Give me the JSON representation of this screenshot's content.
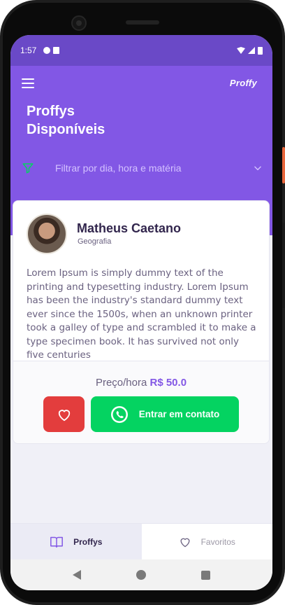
{
  "status_bar": {
    "time": "1:57"
  },
  "header": {
    "brand": "Proffy",
    "title_line1": "Proffys",
    "title_line2": "Disponíveis",
    "filter_label": "Filtrar por dia, hora e matéria"
  },
  "teacher_card": {
    "name": "Matheus Caetano",
    "subject": "Geografia",
    "bio": "Lorem Ipsum is simply dummy text of the printing and typesetting industry. Lorem Ipsum has been the industry's standard dummy text ever since the 1500s, when an unknown printer took a galley of type and scrambled it to make a type specimen book. It has survived not only five centuries",
    "price_label": "Preço/hora",
    "price_value": "R$ 50.0",
    "contact_button": "Entrar em contato"
  },
  "tabs": [
    {
      "label": "Proffys",
      "icon": "book-icon",
      "active": true
    },
    {
      "label": "Favoritos",
      "icon": "heart-icon",
      "active": false
    }
  ],
  "colors": {
    "primary": "#8257e5",
    "status_bar": "#6a49c7",
    "favorite": "#e33d3d",
    "contact": "#04d361",
    "filter_icon": "#04d361"
  }
}
